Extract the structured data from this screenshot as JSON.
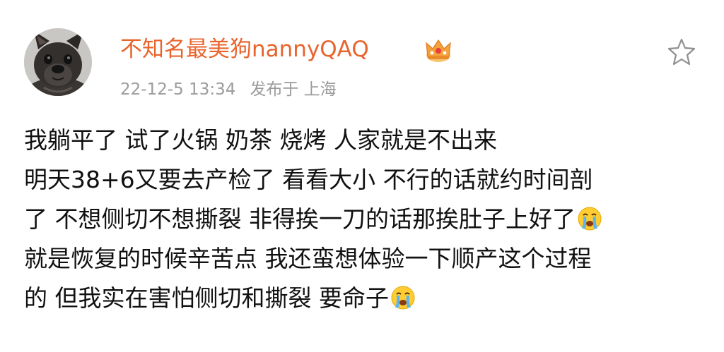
{
  "post": {
    "author": {
      "name": "不知名最美狗nannyQAQ",
      "badge_icon": "crown-icon",
      "avatar_icon": "french-bulldog-avatar"
    },
    "timestamp": "22-12-5 13:34",
    "location": "发布于 上海",
    "action_icon": "star-icon",
    "body_lines": [
      "我躺平了 试了火锅 奶茶 烧烤 人家就是不出来",
      "明天38+6又要去产检了 看看大小 不行的话就约时间剖",
      "了 不想侧切不想撕裂 非得挨一刀的话那挨肚子上好了",
      "就是恢复的时候辛苦点 我还蛮想体验一下顺产这个过程",
      "的 但我实在害怕侧切和撕裂 要命子"
    ],
    "emoji_icon": "crying-face-emoji"
  },
  "colors": {
    "username": "#e8642d",
    "meta": "#9b9b9b",
    "body": "#111111",
    "background": "#ffffff"
  }
}
